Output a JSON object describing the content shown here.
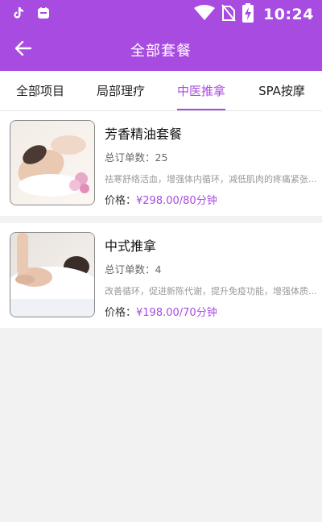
{
  "status_bar": {
    "time": "10:24",
    "icons": [
      "tiktok-icon",
      "app-icon",
      "wifi-icon",
      "no-sim-icon",
      "battery-charging-icon"
    ]
  },
  "app_bar": {
    "title": "全部套餐",
    "back_icon": "arrow-left-icon"
  },
  "tabs": [
    {
      "label": "全部项目",
      "active": false
    },
    {
      "label": "局部理疗",
      "active": false
    },
    {
      "label": "中医推拿",
      "active": true
    },
    {
      "label": "SPA按摩",
      "active": false
    }
  ],
  "packages": [
    {
      "title": "芳香精油套餐",
      "orders_label": "总订单数：",
      "orders": "25",
      "desc": "祛寒舒络活血，增强体内循环，减低肌肉的疼痛紧张...",
      "price_label": "价格：",
      "price": "¥298.00/80分钟"
    },
    {
      "title": "中式推拿",
      "orders_label": "总订单数：",
      "orders": "4",
      "desc": "改善循环，促进新陈代谢，提升免疫功能，增强体质...",
      "price_label": "价格：",
      "price": "¥198.00/70分钟"
    }
  ],
  "colors": {
    "accent": "#a84be0",
    "background": "#f2f2f2"
  }
}
